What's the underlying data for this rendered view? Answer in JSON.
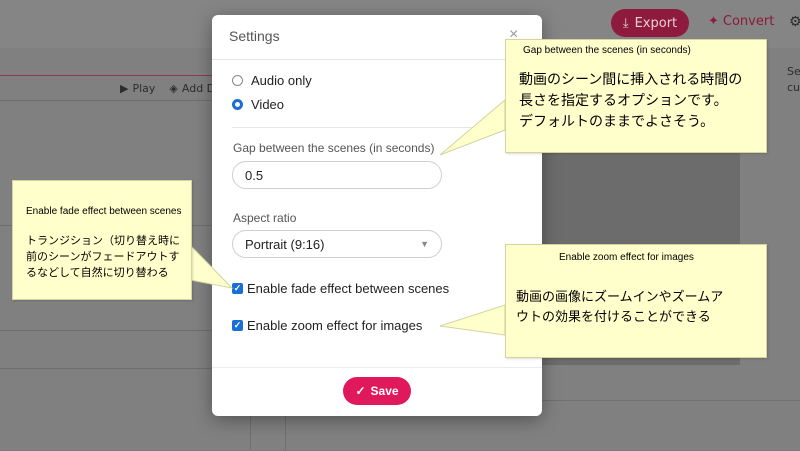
{
  "background_app": {
    "export_label": "Export",
    "convert_label": "Convert",
    "play_label": "Play",
    "add_label": "Add D",
    "right_edge_text_1": "Se",
    "right_edge_text_2": "cu"
  },
  "modal": {
    "title": "Settings",
    "close_symbol": "×",
    "radio_audio_label": "Audio only",
    "radio_video_label": "Video",
    "selected_output": "Video",
    "gap_label": "Gap between the scenes (in seconds)",
    "gap_value": "0.5",
    "aspect_label": "Aspect ratio",
    "aspect_value": "Portrait (9:16)",
    "fade_label": "Enable fade effect between scenes",
    "fade_checked": true,
    "zoom_label": "Enable zoom effect for images",
    "zoom_checked": true,
    "save_label": "Save"
  },
  "callouts": {
    "gap": {
      "title": "Gap between the scenes (in seconds)",
      "line1": "動画のシーン間に挿入される時間の",
      "line2": "長さを指定するオプションです。",
      "line3": "デフォルトのままでよさそう。"
    },
    "fade": {
      "title": "Enable fade effect between scenes",
      "line1": "トランジション（切り替え時に",
      "line2": "前のシーンがフェードアウトす",
      "line3": "るなどして自然に切り替わる"
    },
    "zoom": {
      "title": "Enable zoom effect for images",
      "line1": "動画の画像にズームインやズームア",
      "line2": "ウトの効果を付けることができる"
    }
  },
  "colors": {
    "accent": "#e0185c",
    "radio_blue": "#1a6fd6",
    "callout_bg": "#ffffcc"
  }
}
